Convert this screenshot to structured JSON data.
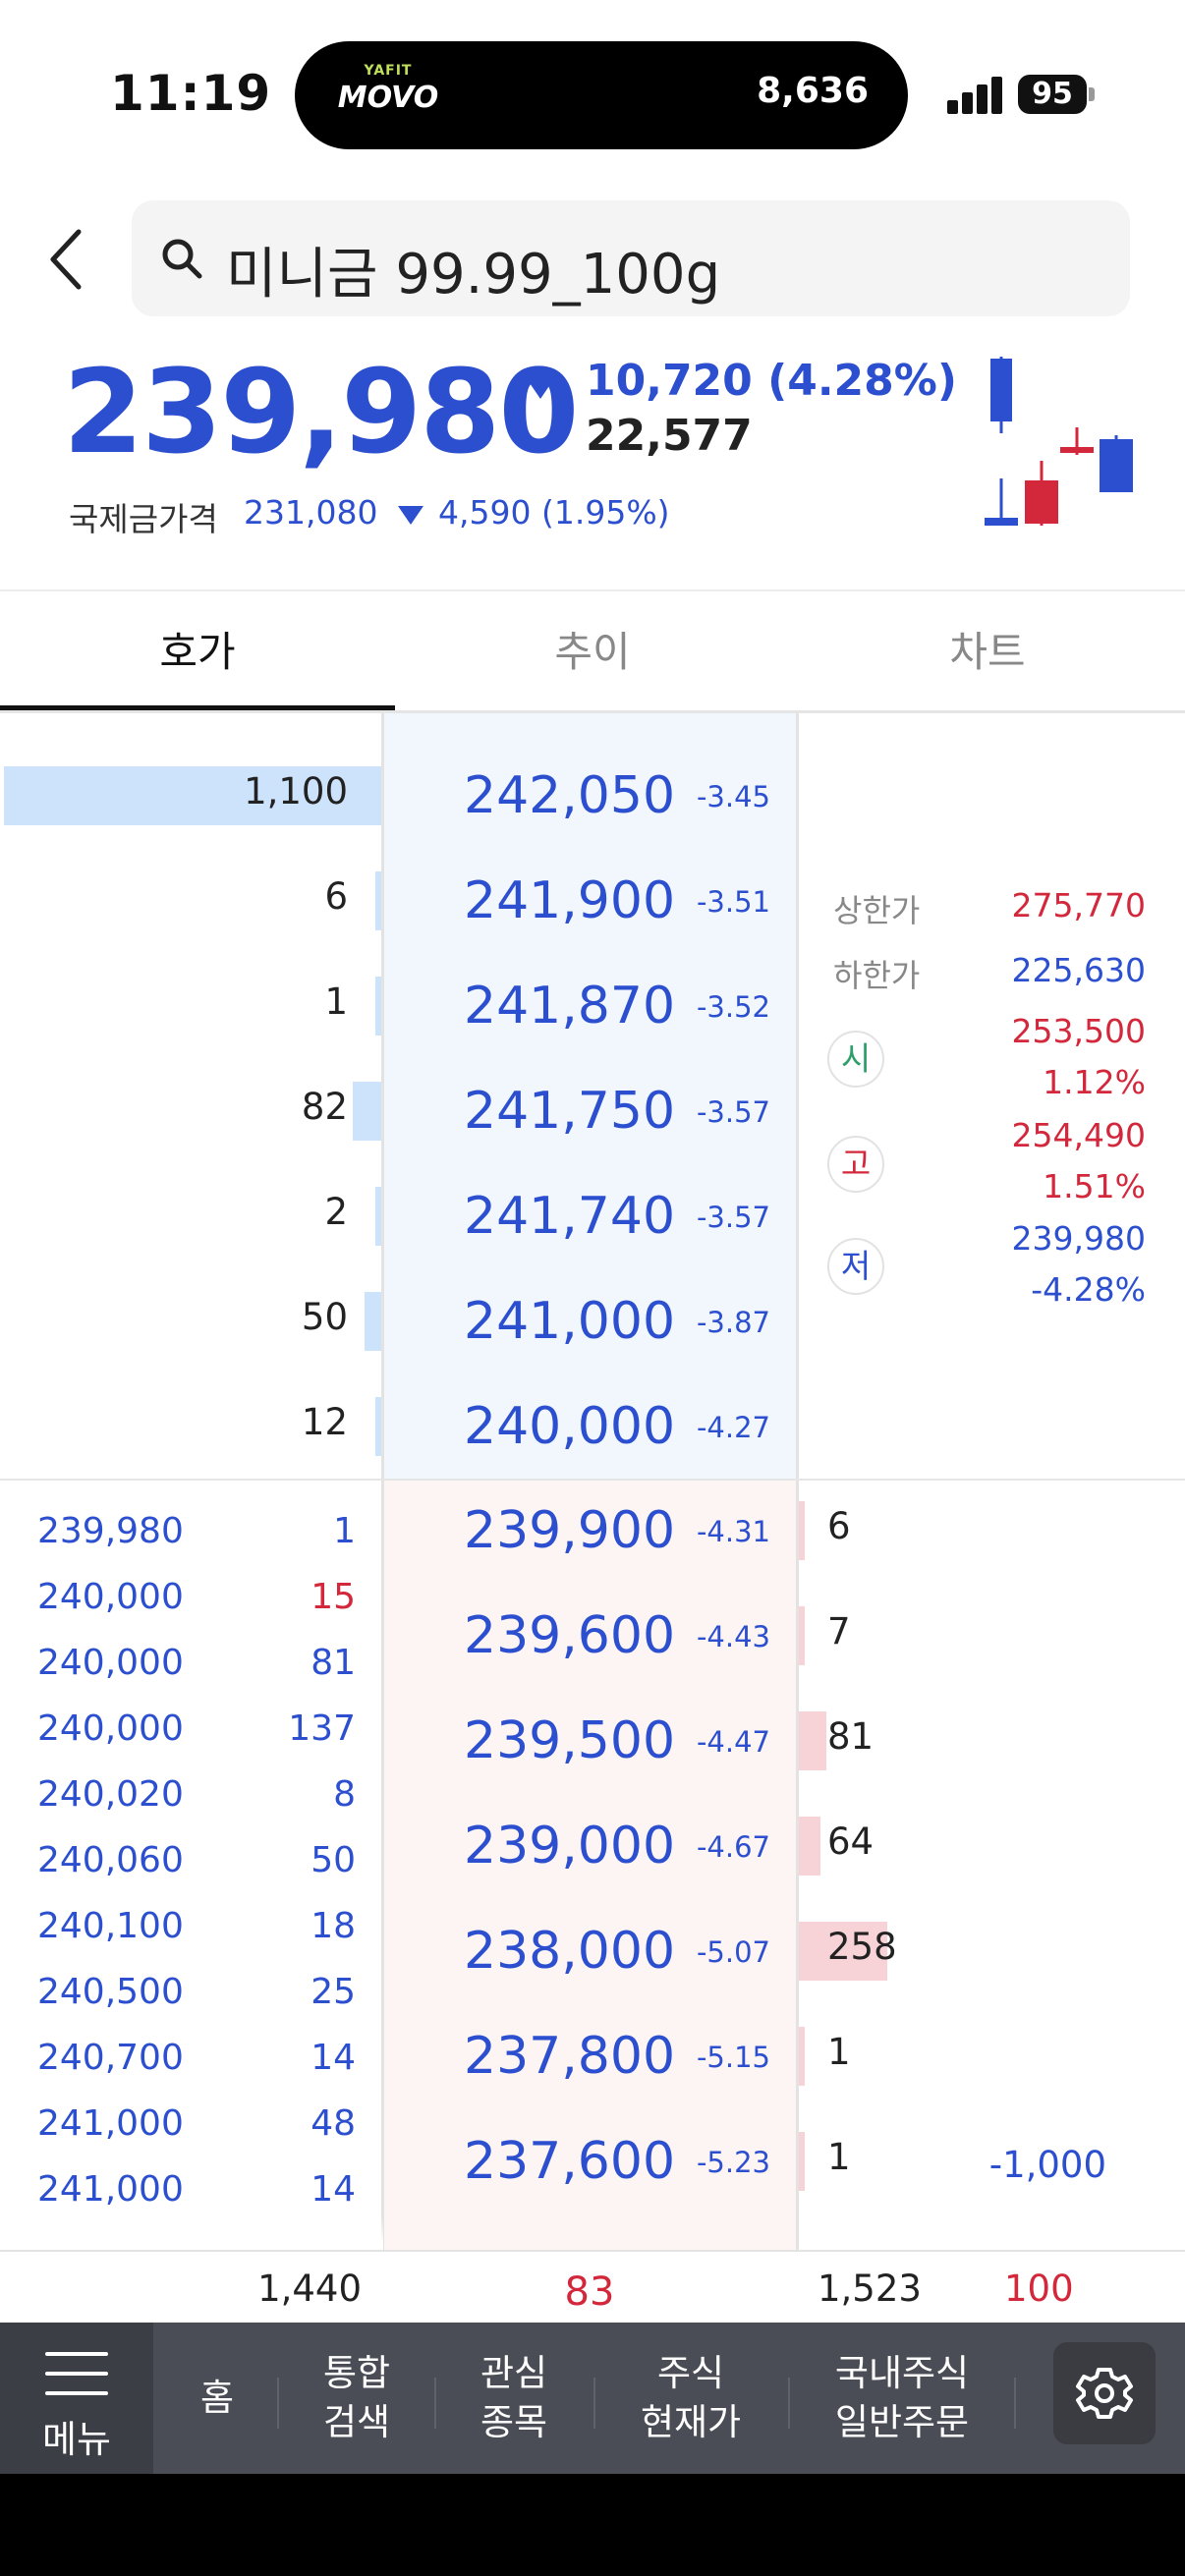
{
  "status_bar": {
    "time": "11:19",
    "island_brand_top": "YAFIT",
    "island_brand": "MOVO",
    "island_steps": "8,636",
    "battery": "95"
  },
  "header": {
    "search_text": "미니금 99.99_100g"
  },
  "summary": {
    "price": "239,980",
    "change": "10,720 (4.28%)",
    "volume": "22,577",
    "intl_label": "국제금가격",
    "intl_price": "231,080",
    "intl_change": "4,590 (1.95%)",
    "down_color": "#2b4fcf",
    "up_color": "#d3283b"
  },
  "tabs": [
    {
      "label": "호가",
      "active": true
    },
    {
      "label": "추이",
      "active": false
    },
    {
      "label": "차트",
      "active": false
    }
  ],
  "asks": [
    {
      "qty": "1,100",
      "qty_num": 1100,
      "price": "242,050",
      "pct": "-3.45"
    },
    {
      "qty": "6",
      "qty_num": 6,
      "price": "241,900",
      "pct": "-3.51"
    },
    {
      "qty": "1",
      "qty_num": 1,
      "price": "241,870",
      "pct": "-3.52"
    },
    {
      "qty": "82",
      "qty_num": 82,
      "price": "241,750",
      "pct": "-3.57"
    },
    {
      "qty": "2",
      "qty_num": 2,
      "price": "241,740",
      "pct": "-3.57"
    },
    {
      "qty": "50",
      "qty_num": 50,
      "price": "241,000",
      "pct": "-3.87"
    },
    {
      "qty": "12",
      "qty_num": 12,
      "price": "240,000",
      "pct": "-4.27"
    }
  ],
  "bids": [
    {
      "price": "239,900",
      "pct": "-4.31",
      "qty": "6",
      "qty_num": 6
    },
    {
      "price": "239,600",
      "pct": "-4.43",
      "qty": "7",
      "qty_num": 7
    },
    {
      "price": "239,500",
      "pct": "-4.47",
      "qty": "81",
      "qty_num": 81
    },
    {
      "price": "239,000",
      "pct": "-4.67",
      "qty": "64",
      "qty_num": 64
    },
    {
      "price": "238,000",
      "pct": "-5.07",
      "qty": "258",
      "qty_num": 258
    },
    {
      "price": "237,800",
      "pct": "-5.15",
      "qty": "1",
      "qty_num": 1
    },
    {
      "price": "237,600",
      "pct": "-5.23",
      "qty": "1",
      "qty_num": 1
    }
  ],
  "bid_qty_max": 258,
  "ask_qty_max": 1100,
  "info": {
    "upper_limit_label": "상한가",
    "upper_limit": "275,770",
    "lower_limit_label": "하한가",
    "lower_limit": "225,630",
    "open_badge": "시",
    "open_price": "253,500",
    "open_pct": "1.12%",
    "high_badge": "고",
    "high_price": "254,490",
    "high_pct": "1.51%",
    "low_badge": "저",
    "low_price": "239,980",
    "low_pct": "-4.28%"
  },
  "trades": [
    {
      "price": "239,980",
      "qty": "1",
      "color": "blue"
    },
    {
      "price": "240,000",
      "qty": "15",
      "color": "red"
    },
    {
      "price": "240,000",
      "qty": "81",
      "color": "blue"
    },
    {
      "price": "240,000",
      "qty": "137",
      "color": "blue"
    },
    {
      "price": "240,020",
      "qty": "8",
      "color": "blue"
    },
    {
      "price": "240,060",
      "qty": "50",
      "color": "blue"
    },
    {
      "price": "240,100",
      "qty": "18",
      "color": "blue"
    },
    {
      "price": "240,500",
      "qty": "25",
      "color": "blue"
    },
    {
      "price": "240,700",
      "qty": "14",
      "color": "blue"
    },
    {
      "price": "241,000",
      "qty": "48",
      "color": "blue"
    },
    {
      "price": "241,000",
      "qty": "14",
      "color": "blue"
    }
  ],
  "bottom_neg": "-1,000",
  "totals": {
    "ask_total": "1,440",
    "middle": "83",
    "bid_total": "1,523",
    "right": "100"
  },
  "nav": {
    "menu": "메뉴",
    "home": "홈",
    "search": "통합\n검색",
    "watchlist": "관심\n종목",
    "quote": "주식\n현재가",
    "order": "국내주식\n일반주문"
  }
}
